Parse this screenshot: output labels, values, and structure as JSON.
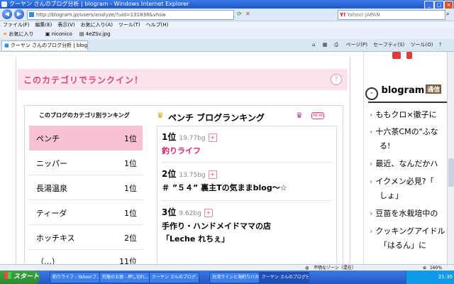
{
  "window": {
    "title": "クーヤン さんのブログ分析 | blogram - Windows Internet Explorer"
  },
  "browser": {
    "url": "http://blogram.jp/users/analyze/?uid=131838&vhsw",
    "search_placeholder": "Yahoo! JAPAN",
    "menu": [
      "ファイル(F)",
      "編集(E)",
      "表示(V)",
      "お気に入り(A)",
      "ツール(T)",
      "ヘルプ(H)"
    ],
    "favorites_label": "お気に入り",
    "favorites": [
      "niconico",
      "4eZSv.jpg"
    ],
    "tab_title": "クーヤン さんのブログ分析 | blogram",
    "tab_tools": [
      "ページ(P)",
      "セーフティ(S)",
      "ツール(O)"
    ]
  },
  "page": {
    "category_heading": "このカテゴリでランクイン！",
    "left_list_title": "このブログのカテゴリ別ランキング",
    "categories": [
      {
        "name": "ペンチ",
        "rank": "1位",
        "selected": true
      },
      {
        "name": "ニッパー",
        "rank": "1位"
      },
      {
        "name": "長湯温泉",
        "rank": "1位"
      },
      {
        "name": "ティーダ",
        "rank": "1位"
      },
      {
        "name": "ホッチキス",
        "rank": "2位"
      },
      {
        "name": "（…）",
        "rank": "11位"
      }
    ],
    "ranking_title": "ペンチ ブログランキング",
    "new_badge": "NEW",
    "entries": [
      {
        "rank": "1位",
        "bg": "19.77bg",
        "name": "釣りライフ"
      },
      {
        "rank": "2位",
        "bg": "13.75bg",
        "name": "＃ ”５４” 裏主Tの気ままblog〜☆"
      },
      {
        "rank": "3位",
        "bg": "9.62bg",
        "name": "手作り・ハンドメイドママの店",
        "name2": "「Leche れちぇ」"
      }
    ],
    "pin_icon": "+"
  },
  "sidebar": {
    "brand": "blogram",
    "brand_suffix": "通信",
    "news": [
      "ももクロ×徹子に",
      "十六茶CMの\"ふな",
      "る!",
      "最近、なんだかハ",
      "イクメン必見?「",
      "しょ」",
      "豆苗を水栽培中の",
      "クッキングアイドル",
      "「はるん」に"
    ]
  },
  "status": {
    "text": "不明なゾーン（混在）",
    "zoom": "160%"
  },
  "taskbar": {
    "start": "スタート",
    "tasks": [
      "釣りライフ - Yahoo!ブ...",
      "究極の五徳 - 押し切れ...",
      "クーヤン さんのブログ...",
      "台湾ラインと海釣りバカ日...",
      "クーヤン さんのブログ分..."
    ],
    "clock": "21:30"
  }
}
